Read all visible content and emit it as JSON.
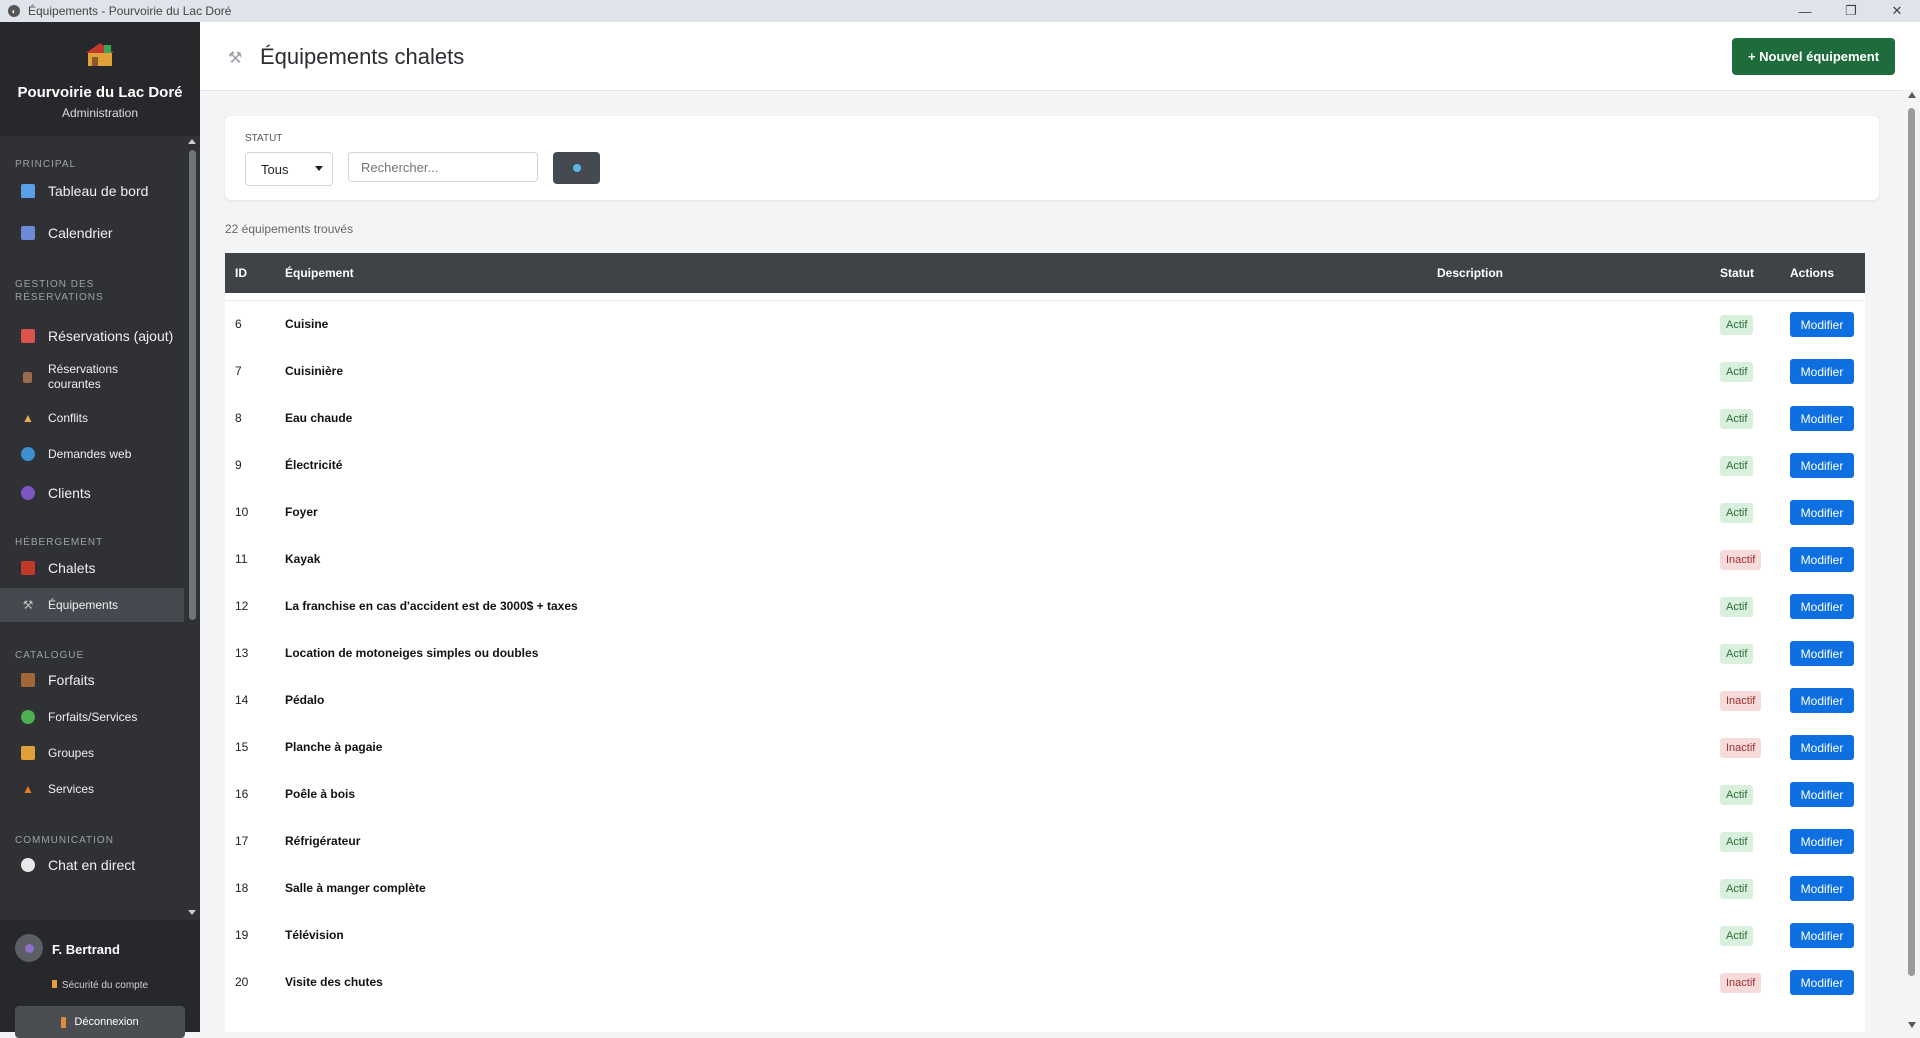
{
  "window": {
    "title": "Équipements - Pourvoirie du Lac Doré"
  },
  "brand": {
    "name": "Pourvoirie du Lac Doré",
    "subtitle": "Administration"
  },
  "sidebar": {
    "sections": {
      "principal": "PRINCIPAL",
      "reservations": "GESTION DES RÉSERVATIONS",
      "hebergement": "HÉBERGEMENT",
      "catalogue": "CATALOGUE",
      "communication": "COMMUNICATION"
    },
    "items": {
      "tableau": "Tableau de bord",
      "calendrier": "Calendrier",
      "res_ajout": "Réservations (ajout)",
      "res_courantes": "Réservations courantes",
      "conflits": "Conflits",
      "demandes": "Demandes web",
      "clients": "Clients",
      "chalets": "Chalets",
      "equipements": "Équipements",
      "forfaits": "Forfaits",
      "forfaits_services": "Forfaits/Services",
      "groupes": "Groupes",
      "services": "Services",
      "chat": "Chat en direct"
    },
    "user": {
      "name": "F. Bertrand",
      "security": "Sécurité du compte",
      "logout": "Déconnexion"
    }
  },
  "header": {
    "title": "Équipements chalets",
    "new_button": "+ Nouvel équipement"
  },
  "filter": {
    "status_label": "STATUT",
    "status_value": "Tous",
    "search_placeholder": "Rechercher..."
  },
  "results": {
    "count_text": "22 équipements trouvés"
  },
  "table": {
    "columns": {
      "id": "ID",
      "name": "Équipement",
      "description": "Description",
      "status": "Statut",
      "actions": "Actions"
    },
    "action_label": "Modifier",
    "rows": [
      {
        "id": "6",
        "name": "Cuisine",
        "status": "Actif"
      },
      {
        "id": "7",
        "name": "Cuisinière",
        "status": "Actif"
      },
      {
        "id": "8",
        "name": "Eau chaude",
        "status": "Actif"
      },
      {
        "id": "9",
        "name": "Électricité",
        "status": "Actif"
      },
      {
        "id": "10",
        "name": "Foyer",
        "status": "Actif"
      },
      {
        "id": "11",
        "name": "Kayak",
        "status": "Inactif"
      },
      {
        "id": "12",
        "name": "La franchise en cas d'accident est de 3000$ + taxes",
        "status": "Actif"
      },
      {
        "id": "13",
        "name": "Location de motoneiges simples ou doubles",
        "status": "Actif"
      },
      {
        "id": "14",
        "name": "Pédalo",
        "status": "Inactif"
      },
      {
        "id": "15",
        "name": "Planche à pagaie",
        "status": "Inactif"
      },
      {
        "id": "16",
        "name": "Poêle à bois",
        "status": "Actif"
      },
      {
        "id": "17",
        "name": "Réfrigérateur",
        "status": "Actif"
      },
      {
        "id": "18",
        "name": "Salle à manger complète",
        "status": "Actif"
      },
      {
        "id": "19",
        "name": "Télévision",
        "status": "Actif"
      },
      {
        "id": "20",
        "name": "Visite des chutes",
        "status": "Inactif"
      }
    ]
  }
}
